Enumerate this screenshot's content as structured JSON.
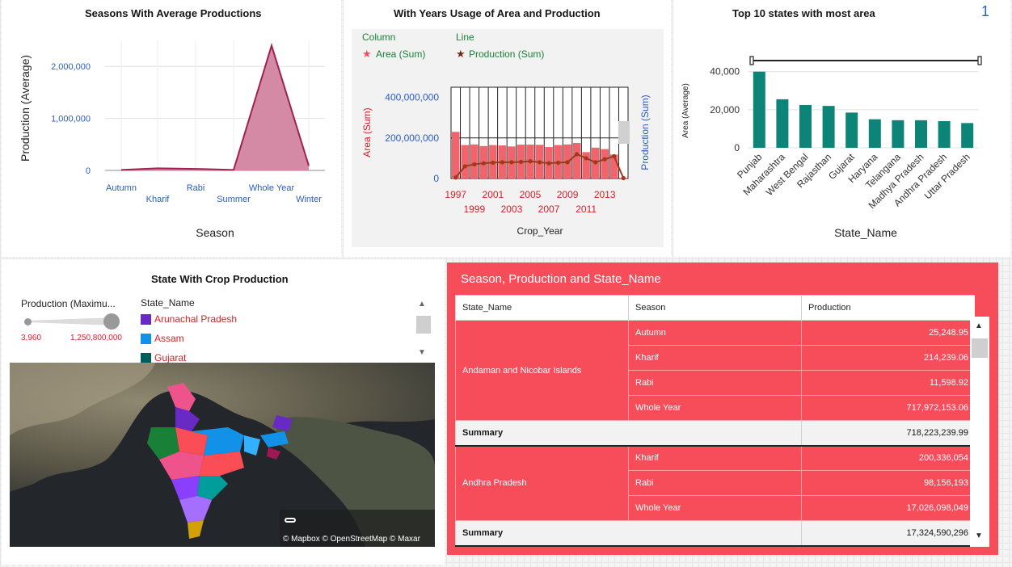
{
  "page_number": "1",
  "colors": {
    "seasons_line": "#a1214e",
    "seasons_fill": "#d48aa5",
    "bar_area": "#f2646c",
    "line_prod": "#9e3a1b",
    "top10_bar": "#0d8478",
    "table_bg": "#f74c5a",
    "axis_blue": "#2b5dbe",
    "label_red": "#da1e28"
  },
  "seasons_panel": {
    "title": "Seasons With Average Productions"
  },
  "years_panel": {
    "title": "With Years Usage of Area and Production",
    "legend": {
      "column_heading": "Column",
      "line_heading": "Line",
      "column_series": "Area (Sum)",
      "line_series": "Production (Sum)",
      "column_icon": "star-icon",
      "line_icon": "star-icon"
    }
  },
  "top10_panel": {
    "title": "Top 10 states with most area"
  },
  "map_panel": {
    "title": "State With Crop Production",
    "size_legend_title": "Production (Maximu...",
    "size_min": "3,960",
    "size_max": "1,250,800,000",
    "color_legend_title": "State_Name",
    "color_legend_items": [
      {
        "label": "Arunachal Pradesh",
        "color": "#6929c4"
      },
      {
        "label": "Assam",
        "color": "#1192e8"
      },
      {
        "label": "Gujarat",
        "color": "#005d5d"
      }
    ],
    "attribution": "© Mapbox © OpenStreetMap © Maxar"
  },
  "table_panel": {
    "title": "Season, Production and State_Name",
    "headers": [
      "State_Name",
      "Season",
      "Production"
    ],
    "groups": [
      {
        "state": "Andaman and Nicobar Islands",
        "rows": [
          {
            "season": "Autumn",
            "production": "25,248.95"
          },
          {
            "season": "Kharif",
            "production": "214,239.06"
          },
          {
            "season": "Rabi",
            "production": "11,598.92"
          },
          {
            "season": "Whole Year",
            "production": "717,972,153.06"
          }
        ],
        "summary_label": "Summary",
        "summary_value": "718,223,239.99"
      },
      {
        "state": "Andhra Pradesh",
        "rows": [
          {
            "season": "Kharif",
            "production": "200,336,054"
          },
          {
            "season": "Rabi",
            "production": "98,156,193"
          },
          {
            "season": "Whole Year",
            "production": "17,026,098,049"
          }
        ],
        "summary_label": "Summary",
        "summary_value": "17,324,590,296"
      }
    ]
  },
  "chart_data": [
    {
      "type": "area",
      "title": "Seasons With Average Productions",
      "xlabel": "Season",
      "ylabel": "Production (Average)",
      "categories": [
        "Autumn",
        "Kharif",
        "Rabi",
        "Summer",
        "Whole Year",
        "Winter"
      ],
      "values": [
        10000,
        40000,
        30000,
        10000,
        2400000,
        90000
      ],
      "yticks": [
        "0",
        "1,000,000",
        "2,000,000"
      ],
      "ylim": [
        0,
        2500000
      ],
      "grid": true
    },
    {
      "type": "bar",
      "title": "With Years Usage of Area and Production",
      "xlabel": "Crop_Year",
      "ylabel": "Area (Sum)",
      "y2label": "Production (Sum)",
      "yticks": [
        "0",
        "200,000,000",
        "400,000,000"
      ],
      "ylim": [
        0,
        450000000
      ],
      "xtick_labels_top": [
        "1997",
        "2001",
        "2005",
        "2009",
        "2013"
      ],
      "xtick_labels_bottom": [
        "1999",
        "2003",
        "2007",
        "2011"
      ],
      "x": [
        1997,
        1998,
        1999,
        2000,
        2001,
        2002,
        2003,
        2004,
        2005,
        2006,
        2007,
        2008,
        2009,
        2010,
        2011,
        2012,
        2013,
        2014,
        2015
      ],
      "series": [
        {
          "name": "Area (Sum)",
          "type": "bar",
          "values": [
            230000000,
            165000000,
            168000000,
            160000000,
            165000000,
            163000000,
            158000000,
            167000000,
            167000000,
            166000000,
            155000000,
            165000000,
            168000000,
            175000000,
            130000000,
            152000000,
            145000000,
            118000000,
            3000000
          ]
        },
        {
          "name": "Production (Sum)",
          "type": "line",
          "values": [
            5000000,
            60000000,
            70000000,
            75000000,
            78000000,
            80000000,
            80000000,
            82000000,
            85000000,
            80000000,
            75000000,
            78000000,
            80000000,
            120000000,
            100000000,
            80000000,
            95000000,
            110000000,
            2000000
          ]
        }
      ],
      "grid": true
    },
    {
      "type": "bar",
      "title": "Top 10 states with most area",
      "xlabel": "State_Name",
      "ylabel": "Area (Average)",
      "categories": [
        "Punjab",
        "Maharashtra",
        "West Bengal",
        "Rajasthan",
        "Gujarat",
        "Haryana",
        "Telangana",
        "Madhya Pradesh",
        "Andhra Pradesh",
        "Uttar Pradesh"
      ],
      "values": [
        40000,
        25500,
        22500,
        22000,
        18500,
        15000,
        14500,
        14500,
        14000,
        13000
      ],
      "yticks": [
        "0",
        "20,000",
        "40,000"
      ],
      "ylim": [
        0,
        42000
      ],
      "grid": true
    }
  ]
}
